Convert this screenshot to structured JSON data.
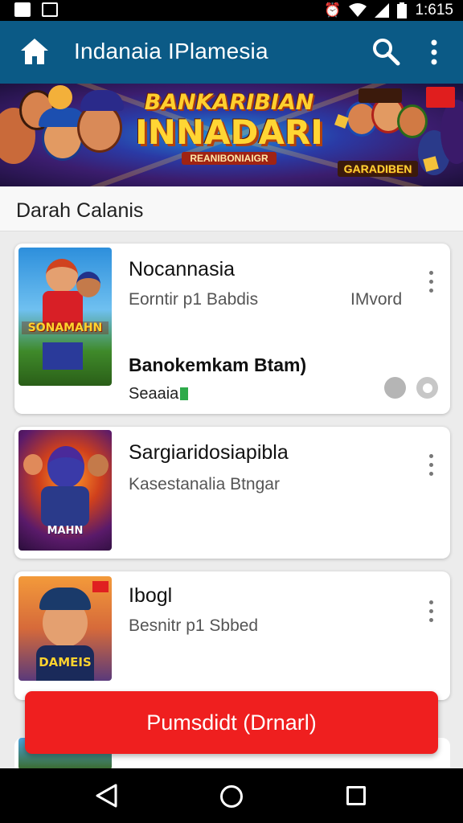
{
  "status_bar": {
    "time": "1:615",
    "icons": [
      "image-icon",
      "photo-icon",
      "alarm-icon",
      "wifi-icon",
      "signal-icon",
      "battery-icon"
    ]
  },
  "app_bar": {
    "title": "Indanaia IPlamesia",
    "icons": [
      "home-icon",
      "search-icon",
      "more-vert-icon"
    ],
    "color": "#0b5a86"
  },
  "banner": {
    "line1": "BANKARIBIAN",
    "line2": "INNADARI",
    "line3": "REANIBONIAIGR",
    "right_label": "GARADIBEN"
  },
  "section": {
    "title": "Darah Calanis"
  },
  "cards": [
    {
      "title": "Nocannasia",
      "subtitle": "Eorntir p1 Babdis",
      "meta": "IMvord",
      "detail_title": "Banokemkam Btam)",
      "detail_sub": "Seaaia",
      "thumb_label": "SONAMAHN"
    },
    {
      "title": "Sargiaridosiapibla",
      "subtitle": "Kasestanalia Btngar",
      "thumb_label": "MAHN"
    },
    {
      "title": "Ibogl",
      "subtitle": "Besnitr p1 Sbbed",
      "thumb_label": "DAMEIS"
    }
  ],
  "cta": {
    "label": "Pumsdidt (Drnarl)",
    "color": "#ef1f1f"
  },
  "nav": {
    "icons": [
      "back-icon",
      "home-circle-icon",
      "recents-icon"
    ]
  }
}
